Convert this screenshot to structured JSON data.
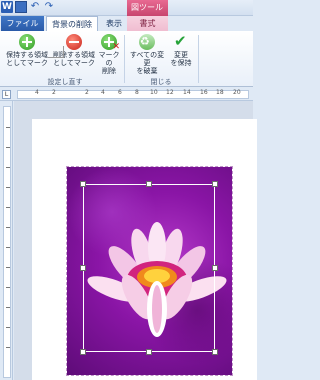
{
  "app": {
    "logo_letter": "W"
  },
  "quick_access": {
    "save_icon": "save-icon",
    "undo_icon": "undo-icon",
    "redo_icon": "redo-icon"
  },
  "context_title": "図ツール",
  "tabs": [
    {
      "label": "ファイル"
    },
    {
      "label": "背景の削除"
    },
    {
      "label": "表示"
    },
    {
      "label": "書式"
    }
  ],
  "ribbon": {
    "buttons": [
      {
        "label": "保持する領域\nとしてマーク",
        "icon": "mark-keep-icon"
      },
      {
        "label": "削除する領域\nとしてマーク",
        "icon": "mark-remove-icon"
      },
      {
        "label": "マークの\n削除",
        "icon": "delete-mark-icon"
      },
      {
        "label": "すべての変更\nを破棄",
        "icon": "discard-changes-icon"
      },
      {
        "label": "変更\nを保持",
        "icon": "keep-changes-icon"
      }
    ],
    "groups": [
      {
        "label": "設定し直す"
      },
      {
        "label": "閉じる"
      }
    ]
  },
  "ruler": {
    "tab_selector": "L",
    "numbers": [
      "4",
      "2",
      "2",
      "4",
      "6",
      "8",
      "10",
      "12",
      "14",
      "16",
      "18",
      "20"
    ]
  },
  "colors": {
    "file_tab": "#2a5aa8",
    "context_accent": "#c8456e",
    "picture_bg": "#8a15a6"
  }
}
